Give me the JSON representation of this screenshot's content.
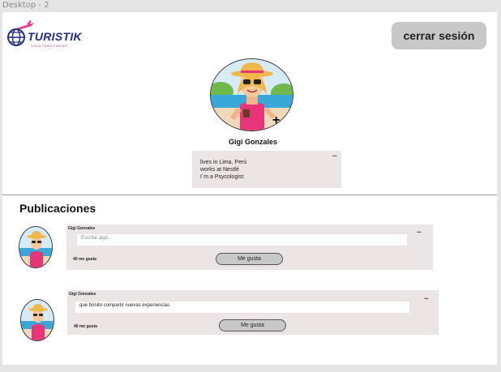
{
  "frame": {
    "label": "Desktop - 2"
  },
  "header": {
    "logo_text": "TURISTIK",
    "logo_tagline": "SOLO PARA CHICAS",
    "logout_label": "cerrar sesión"
  },
  "profile": {
    "name": "Gigi Gonzales",
    "bio": [
      "lives in Lima, Perú",
      "works at Nestlé",
      "I´m a Psycologist"
    ],
    "menu_glyph": "..."
  },
  "feed": {
    "title": "Publicaciones",
    "posts": [
      {
        "author": "Gigi Gonzales",
        "text": "",
        "placeholder": "Escribe algo...",
        "likes": "40 me gusta",
        "like_label": "Me gusta",
        "menu_glyph": "..."
      },
      {
        "author": "Gigi Gonzales",
        "text": "que bonito compartir nuevas experiencias",
        "placeholder": "",
        "likes": "40 me gusta",
        "like_label": "Me gusta",
        "menu_glyph": "..."
      }
    ]
  },
  "colors": {
    "card": "#ece5e5",
    "button": "#c8c8c8",
    "brand": "#1f2d8a",
    "accent": "#c0398a"
  }
}
